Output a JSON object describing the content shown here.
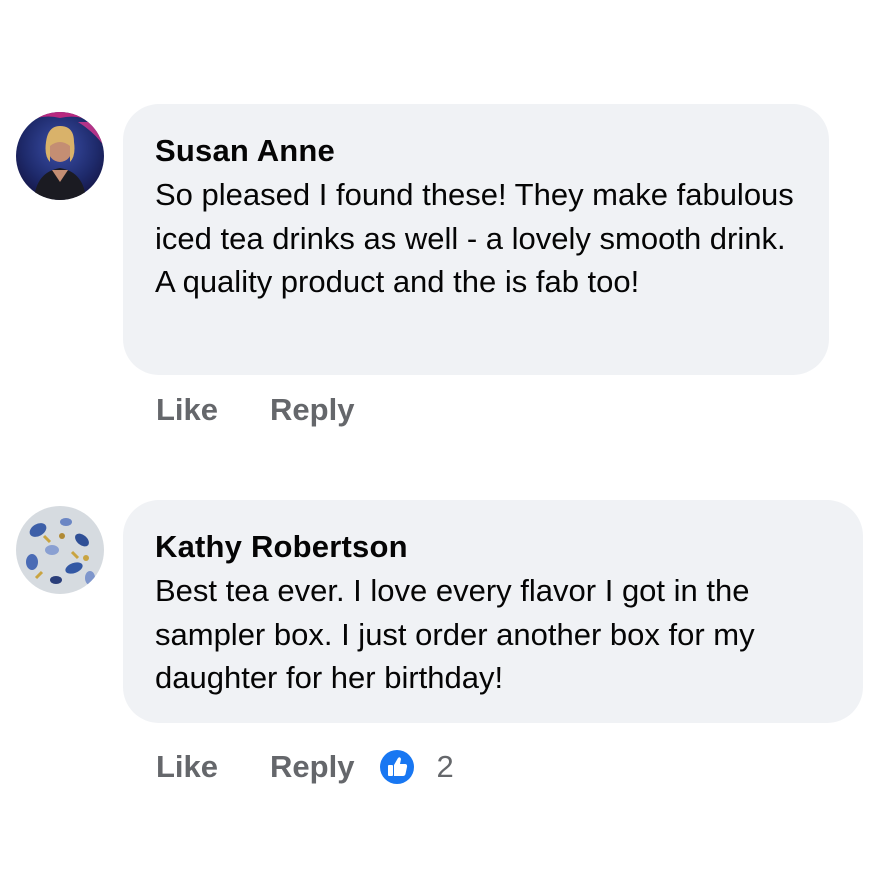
{
  "comments": [
    {
      "author": "Susan Anne",
      "text": "So pleased I found these! They make fabulous iced tea drinks as well - a lovely smooth drink. A quality product and the is fab too!",
      "actions": {
        "like": "Like",
        "reply": "Reply"
      }
    },
    {
      "author": "Kathy Robertson",
      "text": "Best tea ever. I love every flavor I got in the sampler box. I just order another box for my daughter for her birthday!",
      "actions": {
        "like": "Like",
        "reply": "Reply"
      },
      "reactions": {
        "icon": "thumbs-up-icon",
        "count": "2"
      }
    }
  ],
  "colors": {
    "bubble": "#f0f2f5",
    "action_text": "#65676b",
    "like_blue": "#1877f2"
  }
}
